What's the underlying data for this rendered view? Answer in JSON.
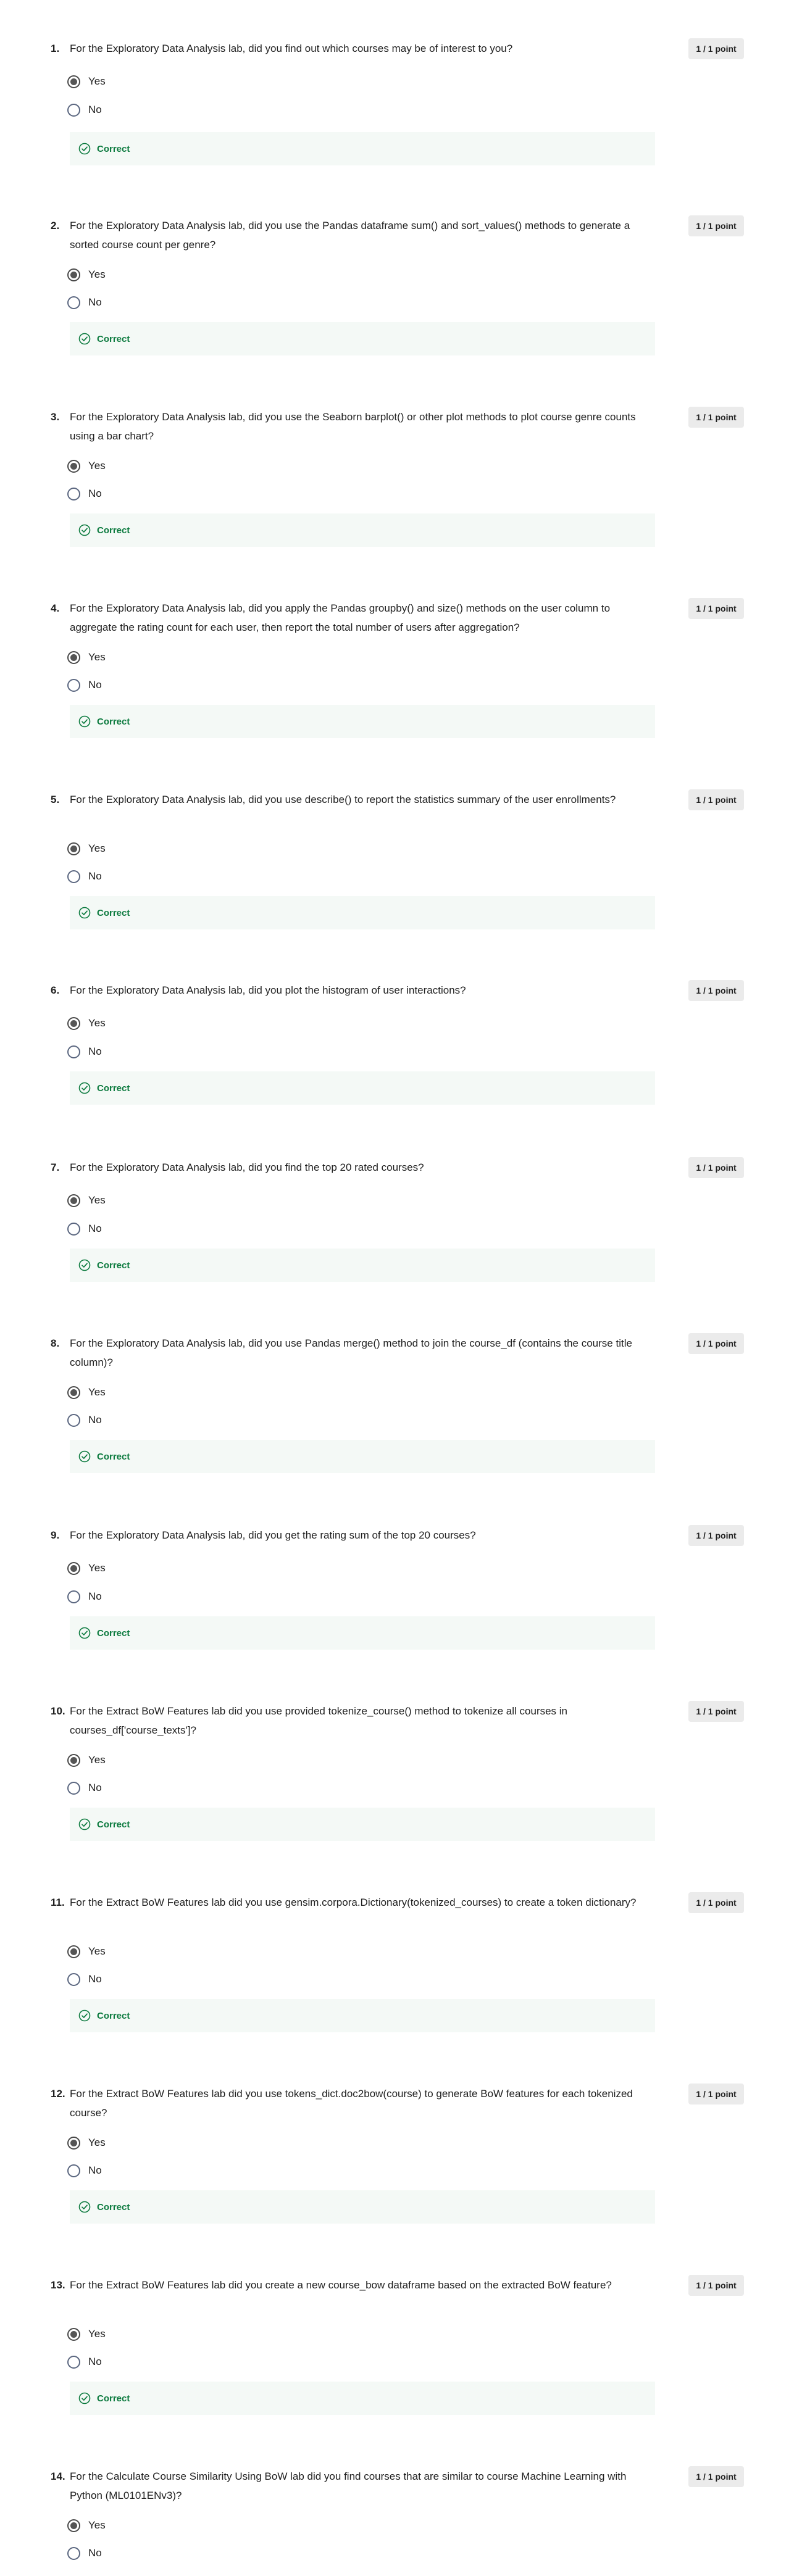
{
  "questions": [
    {
      "number": "1.",
      "text": "For the Exploratory Data Analysis lab, did you find out which courses may be of interest to you?",
      "points": "1 / 1 point",
      "options": [
        "Yes",
        "No"
      ],
      "selected": 0,
      "feedback": "Correct"
    },
    {
      "number": "2.",
      "text": "For the Exploratory Data Analysis lab, did you use the Pandas dataframe sum() and sort_values() methods to generate a sorted course count per genre?",
      "points": "1 / 1 point",
      "options": [
        "Yes",
        "No"
      ],
      "selected": 0,
      "feedback": "Correct"
    },
    {
      "number": "3.",
      "text": "For the Exploratory Data Analysis lab, did you use the Seaborn barplot() or other plot methods to plot course genre counts using a bar chart?",
      "points": "1 / 1 point",
      "options": [
        "Yes",
        "No"
      ],
      "selected": 0,
      "feedback": "Correct"
    },
    {
      "number": "4.",
      "text": "For the Exploratory Data Analysis lab, did you apply the Pandas groupby() and size() methods on the user column to aggregate the rating count for each user, then report the total number of users after aggregation?",
      "points": "1 / 1 point",
      "options": [
        "Yes",
        "No"
      ],
      "selected": 0,
      "feedback": "Correct"
    },
    {
      "number": "5.",
      "text": "For the Exploratory Data Analysis lab, did you use describe() to report the statistics summary of the user enrollments?",
      "points": "1 / 1 point",
      "options": [
        "Yes",
        "No"
      ],
      "selected": 0,
      "feedback": "Correct"
    },
    {
      "number": "6.",
      "text": "For the Exploratory Data Analysis lab, did you plot the histogram of user interactions?",
      "points": "1 / 1 point",
      "options": [
        "Yes",
        "No"
      ],
      "selected": 0,
      "feedback": "Correct"
    },
    {
      "number": "7.",
      "text": "For the Exploratory Data Analysis lab, did you find the top 20 rated courses?",
      "points": "1 / 1 point",
      "options": [
        "Yes",
        "No"
      ],
      "selected": 0,
      "feedback": "Correct"
    },
    {
      "number": "8.",
      "text": "For the Exploratory Data Analysis lab, did you use Pandas merge() method to join the course_df (contains the course title column)?",
      "points": "1 / 1 point",
      "options": [
        "Yes",
        "No"
      ],
      "selected": 0,
      "feedback": "Correct"
    },
    {
      "number": "9.",
      "text": "For the Exploratory Data Analysis lab, did you get the rating sum of the top 20 courses?",
      "points": "1 / 1 point",
      "options": [
        "Yes",
        "No"
      ],
      "selected": 0,
      "feedback": "Correct"
    },
    {
      "number": "10.",
      "text": "For the Extract BoW Features lab did you use provided tokenize_course() method to tokenize all courses in courses_df['course_texts']?",
      "points": "1 / 1 point",
      "options": [
        "Yes",
        "No"
      ],
      "selected": 0,
      "feedback": "Correct"
    },
    {
      "number": "11.",
      "text": "For the Extract BoW Features lab did you use gensim.corpora.Dictionary(tokenized_courses) to create a token dictionary?",
      "points": "1 / 1 point",
      "options": [
        "Yes",
        "No"
      ],
      "selected": 0,
      "feedback": "Correct"
    },
    {
      "number": "12.",
      "text": "For the Extract BoW Features lab did you use tokens_dict.doc2bow(course) to generate BoW features for each tokenized course?",
      "points": "1 / 1 point",
      "options": [
        "Yes",
        "No"
      ],
      "selected": 0,
      "feedback": "Correct"
    },
    {
      "number": "13.",
      "text": "For the Extract BoW Features lab did you create a new course_bow dataframe based on the extracted BoW feature?",
      "points": "1 / 1 point",
      "options": [
        "Yes",
        "No"
      ],
      "selected": 0,
      "feedback": "Correct"
    },
    {
      "number": "14.",
      "text": "For the Calculate Course Similarity Using BoW lab did you find courses that are similar to course Machine Learning with Python (ML0101ENv3)?",
      "points": "1 / 1 point",
      "options": [
        "Yes",
        "No"
      ],
      "selected": 0,
      "feedback": ""
    }
  ],
  "colors": {
    "correct": "#0b7a3e",
    "feedback_bg": "#f4f9f6",
    "badge_bg": "#ebebeb"
  },
  "icons": {
    "feedback": "check-circle-icon"
  }
}
